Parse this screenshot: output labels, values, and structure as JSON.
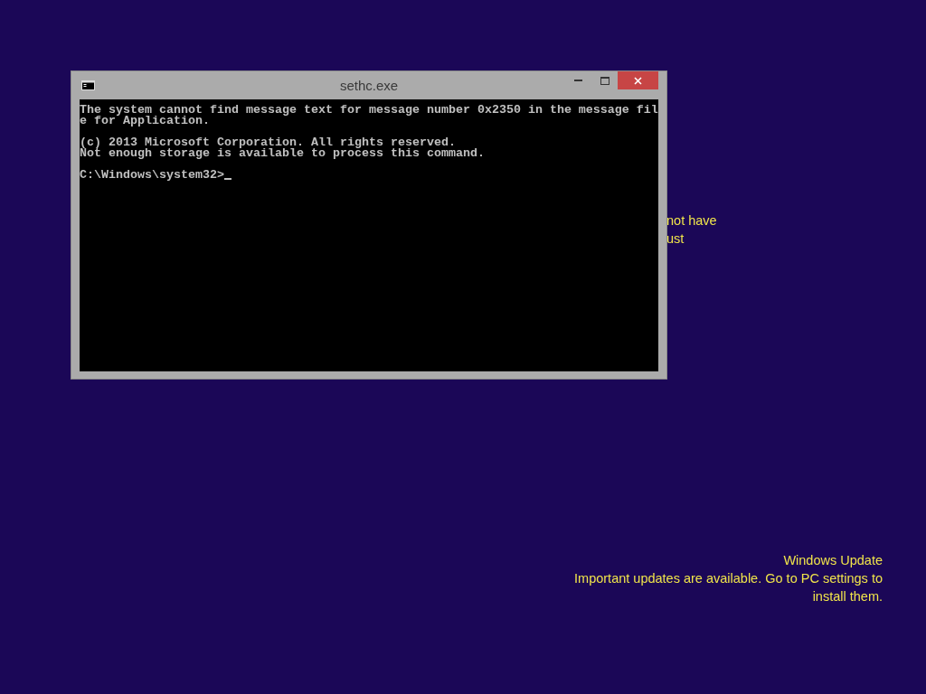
{
  "background_text": [
    "not have",
    "ust"
  ],
  "window": {
    "title": "sethc.exe",
    "console": [
      {
        "lines": [
          "The system cannot find message text for message number 0x2350 in the message fil",
          "e for Application."
        ]
      },
      {
        "lines": [
          "(c) 2013 Microsoft Corporation. All rights reserved.",
          "Not enough storage is available to process this command."
        ]
      },
      {
        "lines": [
          "C:\\Windows\\system32>"
        ]
      }
    ]
  },
  "notification": {
    "title": "Windows Update",
    "message": "Important updates are available. Go to PC settings to install them."
  }
}
